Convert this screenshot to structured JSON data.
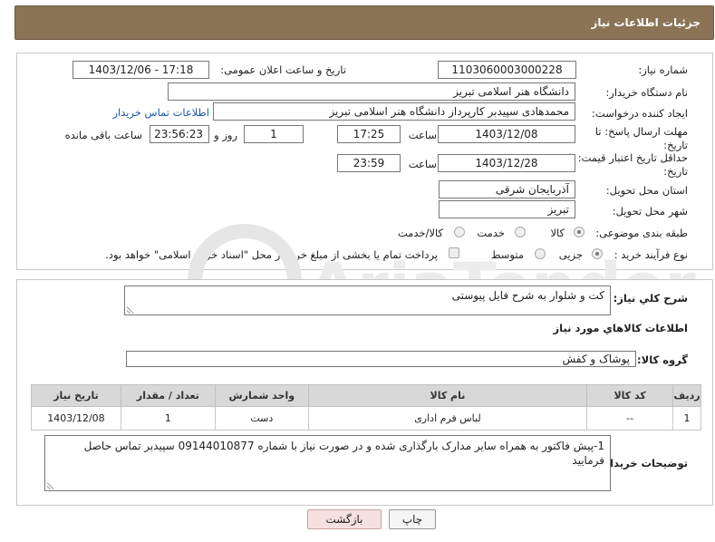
{
  "header": {
    "title": "جزئیات اطلاعات نیاز"
  },
  "fields": {
    "need_number_label": "شماره نیاز:",
    "need_number": "1103060003000228",
    "announce_label": "تاریخ و ساعت اعلان عمومی:",
    "announce_value": "1403/12/06 - 17:18",
    "buyer_org_label": "نام دستگاه خریدار:",
    "buyer_org": "دانشگاه هنر اسلامی تبریز",
    "creator_label": "ایجاد کننده درخواست:",
    "creator": "محمدهادی سپیدبر کارپرداز دانشگاه هنر اسلامی تبریز",
    "contact_link": "اطلاعات تماس خریدار",
    "reply_deadline_label": "مهلت ارسال پاسخ: تا تاریخ:",
    "reply_date": "1403/12/08",
    "time_label": "ساعت",
    "reply_time": "17:25",
    "days_value": "1",
    "days_label": "روز و",
    "remaining_time": "23:56:23",
    "remaining_label": "ساعت باقی مانده",
    "price_deadline_label": "حداقل تاریخ اعتبار قیمت: تا تاریخ:",
    "price_date": "1403/12/28",
    "price_time": "23:59",
    "province_label": "استان محل تحویل:",
    "province": "آذربایجان شرقی",
    "city_label": "شهر محل تحویل:",
    "city": "تبریز",
    "category_label": "طبقه بندی موضوعی:",
    "category_options": [
      "کالا",
      "خدمت",
      "کالا/خدمت"
    ],
    "process_label": "نوع فرآیند خرید :",
    "process_options": [
      "جزیی",
      "متوسط"
    ],
    "payment_note": "پرداخت تمام یا بخشی از مبلغ خرید،از محل \"اسناد خزانه اسلامی\" خواهد بود."
  },
  "details": {
    "summary_label": "شرح کلي نياز:",
    "summary": "کت و شلوار به شرح فایل پیوستی",
    "goods_info_title": "اطلاعات کالاهاي مورد نياز",
    "goods_group_label": "گروه کالا:",
    "goods_group": "پوشاک و کفش"
  },
  "table": {
    "headers": [
      "ردیف",
      "کد کالا",
      "نام کالا",
      "واحد شمارش",
      "تعداد / مقدار",
      "تاریخ نیاز"
    ],
    "rows": [
      [
        "1",
        "--",
        "لباس فرم اداری",
        "دست",
        "1",
        "1403/12/08"
      ]
    ]
  },
  "buyer_notes": {
    "label": "توضیحات خریدار:",
    "text": "1-پیش فاکتور به همراه سایر مدارک بارگذاری شده و در صورت نیاز با شماره 09144010877 سپیدبر تماس حاصل فرمایید"
  },
  "buttons": {
    "print": "چاپ",
    "back": "بازگشت"
  },
  "watermark": {
    "text": "AriaTender.net"
  }
}
